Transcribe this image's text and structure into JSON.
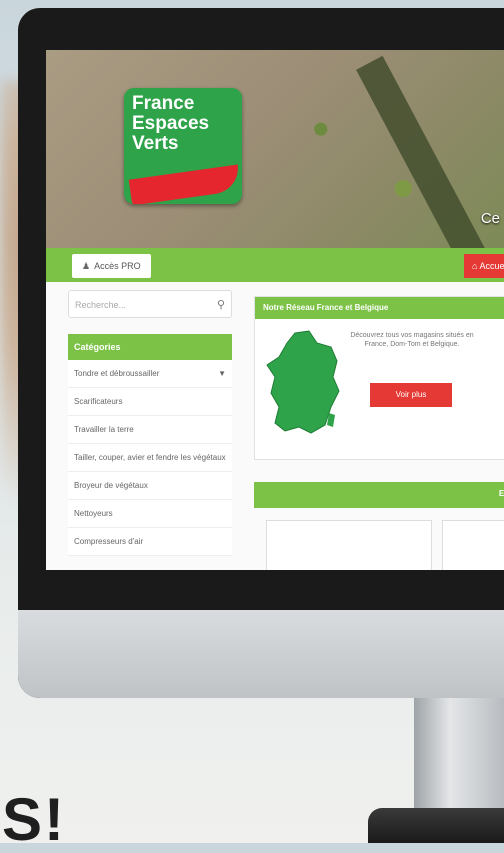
{
  "hero": {
    "caption": "Ce"
  },
  "logo": {
    "lines": [
      "France",
      "Espaces",
      "Verts"
    ]
  },
  "nav": {
    "access_label": "Accès PRO",
    "home_label": "Accueil"
  },
  "sidebar": {
    "search_placeholder": "Recherche...",
    "categories_title": "Catégories",
    "items": [
      "Tondre et débroussailler",
      "Scarificateurs",
      "Travailler la terre",
      "Tailler, couper, avier et fendre les végétaux",
      "Broyeur de végétaux",
      "Nettoyeurs",
      "Compresseurs d'air"
    ]
  },
  "map_card": {
    "title": "Notre Réseau France et Belgique",
    "text": "Découvrez tous vos magasins situés en France, Dom-Tom et Belgique.",
    "button": "Voir plus"
  },
  "section2": {
    "title": "EN"
  },
  "tagline": "S!",
  "colors": {
    "brand_green": "#7cc247",
    "logo_green": "#2ea34a",
    "accent_red": "#e53935"
  }
}
